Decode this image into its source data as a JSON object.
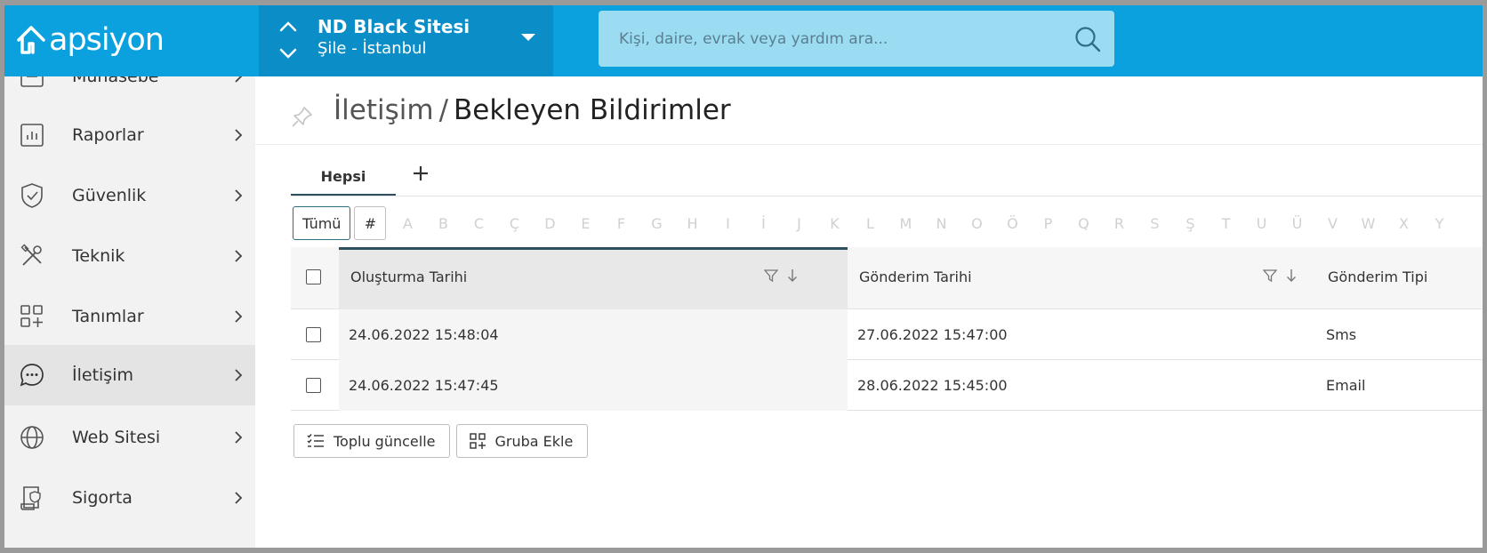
{
  "header": {
    "logo_text": "apsiyon",
    "site_name": "ND Black Sitesi",
    "site_location": "Şile - İstanbul",
    "search_placeholder": "Kişi, daire, evrak veya yardım ara..."
  },
  "sidebar": {
    "items": [
      {
        "label": "Muhasebe",
        "icon": "accounting-icon",
        "active": false
      },
      {
        "label": "Raporlar",
        "icon": "report-chart-icon",
        "active": false
      },
      {
        "label": "Güvenlik",
        "icon": "shield-check-icon",
        "active": false
      },
      {
        "label": "Teknik",
        "icon": "tools-icon",
        "active": false
      },
      {
        "label": "Tanımlar",
        "icon": "grid-plus-icon",
        "active": false
      },
      {
        "label": "İletişim",
        "icon": "chat-bubble-icon",
        "active": true
      },
      {
        "label": "Web Sitesi",
        "icon": "globe-icon",
        "active": false
      },
      {
        "label": "Sigorta",
        "icon": "insurance-document-icon",
        "active": false
      }
    ]
  },
  "page": {
    "breadcrumb_parent": "İletişim",
    "breadcrumb_separator": "/",
    "title": "Bekleyen Bildirimler"
  },
  "tabs": {
    "active": "Hepsi",
    "add_label": "+"
  },
  "letter_filter": {
    "all_label": "Tümü",
    "hash_label": "#",
    "letters": [
      "A",
      "B",
      "C",
      "Ç",
      "D",
      "E",
      "F",
      "G",
      "H",
      "I",
      "İ",
      "J",
      "K",
      "L",
      "M",
      "N",
      "O",
      "Ö",
      "P",
      "Q",
      "R",
      "S",
      "Ş",
      "T",
      "U",
      "Ü",
      "V",
      "W",
      "X",
      "Y"
    ]
  },
  "table": {
    "columns": [
      "Oluşturma Tarihi",
      "Gönderim Tarihi",
      "Gönderim Tipi"
    ],
    "rows": [
      {
        "created": "24.06.2022 15:48:04",
        "sent": "27.06.2022 15:47:00",
        "type": "Sms"
      },
      {
        "created": "24.06.2022 15:47:45",
        "sent": "28.06.2022 15:45:00",
        "type": "Email"
      }
    ]
  },
  "actions": {
    "bulk_update": "Toplu güncelle",
    "add_to_group": "Gruba Ekle"
  },
  "colors": {
    "topbar": "#0aa1de",
    "site_switch": "#0b8ec7",
    "search_bg": "#9bdcf3",
    "sidebar_bg": "#f2f2f2",
    "accent_dark": "#2f4f5f"
  }
}
